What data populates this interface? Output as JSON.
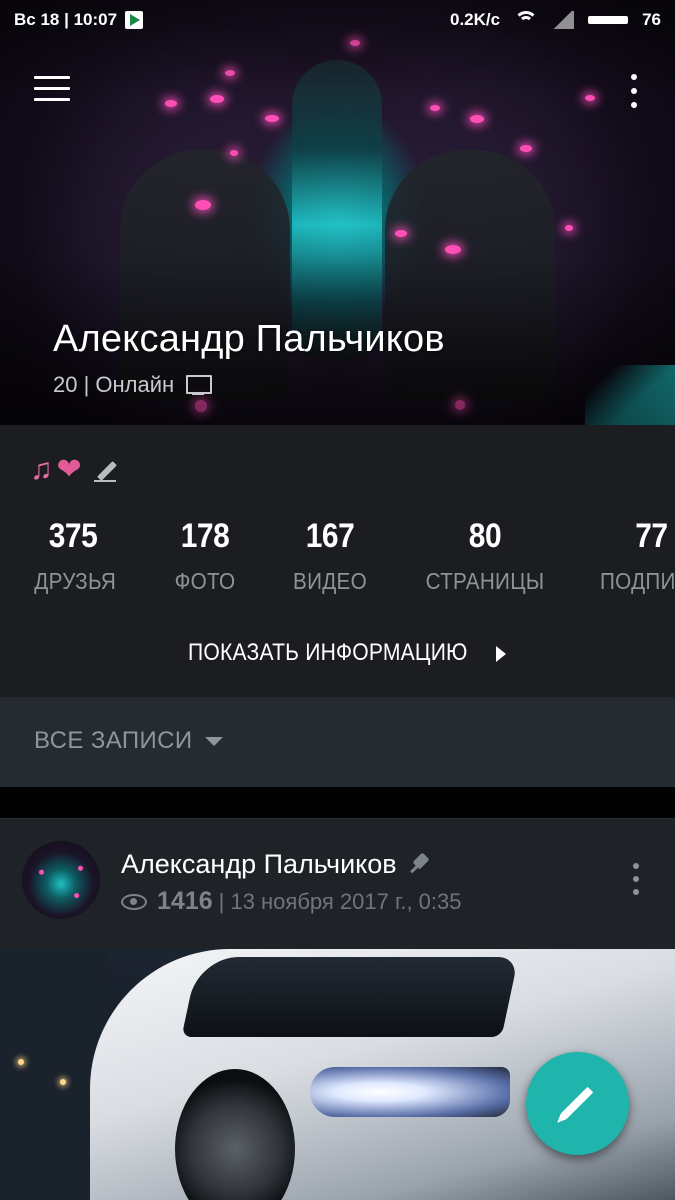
{
  "status_bar": {
    "time": "Вс 18 | 10:07",
    "network_speed": "0.2K/c",
    "battery": "76"
  },
  "profile": {
    "name": "Александр Пальчиков",
    "status": "20 | Онлайн",
    "status_emoji": "🎶❤"
  },
  "counters": [
    {
      "value": "375",
      "label": "ДРУЗЬЯ"
    },
    {
      "value": "178",
      "label": "ФОТО"
    },
    {
      "value": "167",
      "label": "ВИДЕО"
    },
    {
      "value": "80",
      "label": "СТРАНИЦЫ"
    },
    {
      "value": "77",
      "label": "ПОДПИ"
    }
  ],
  "show_info_label": "ПОКАЗАТЬ ИНФОРМАЦИЮ",
  "filter_label": "ВСЕ ЗАПИСИ",
  "post": {
    "author": "Александр Пальчиков",
    "views": "1416",
    "date": "| 13 ноября 2017 г., 0:35"
  },
  "icons": {
    "menu": "hamburger-menu-icon",
    "more": "more-vertical-icon",
    "monitor": "monitor-icon",
    "edit": "pencil-icon",
    "pin": "pin-icon",
    "eye": "eye-icon",
    "fab": "edit-icon"
  },
  "colors": {
    "accent": "#1fb5ac",
    "panel_bg": "#1b1d21",
    "filter_bg": "#262b31",
    "post_bg": "#1f2226",
    "muted_text": "#8e939a"
  }
}
